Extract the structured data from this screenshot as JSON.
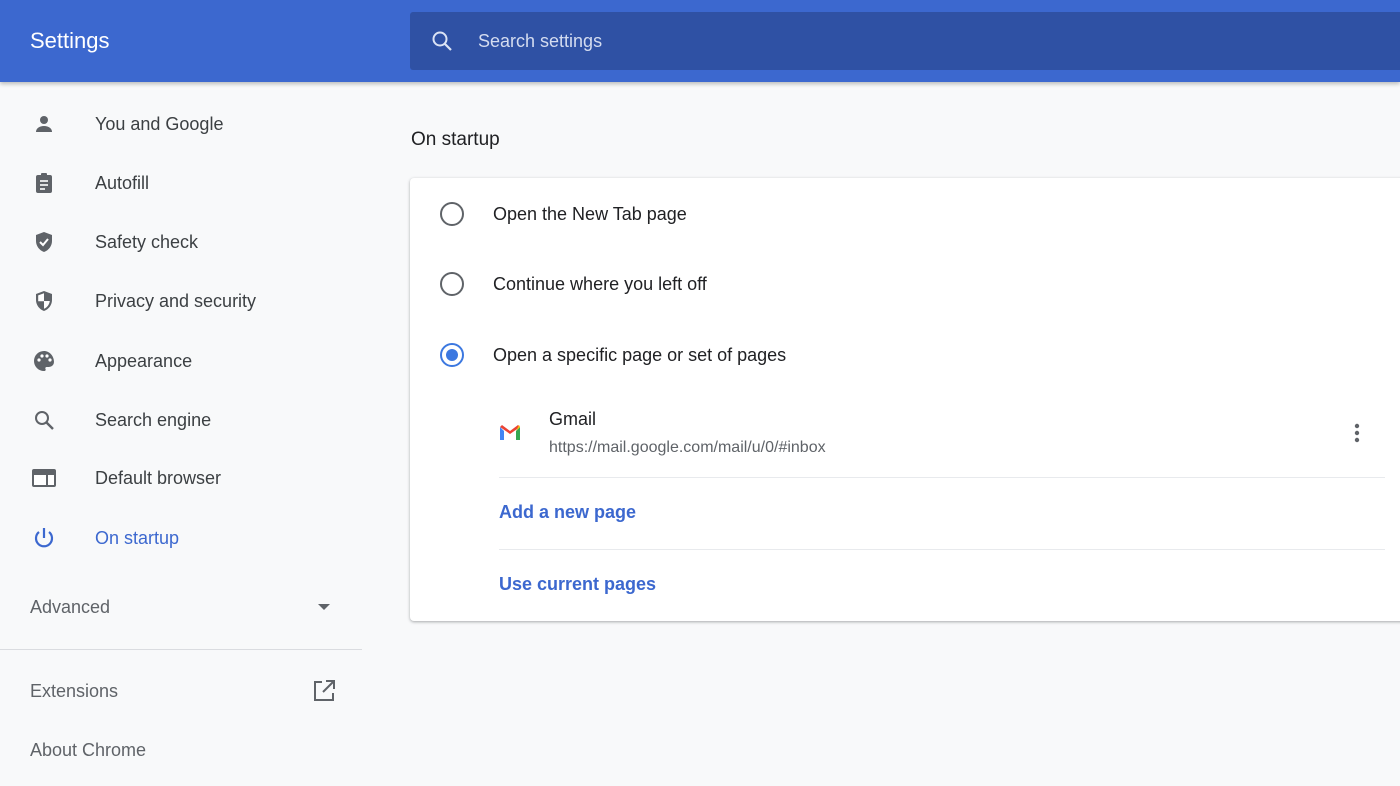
{
  "header": {
    "title": "Settings",
    "search_placeholder": "Search settings"
  },
  "sidebar": {
    "items": [
      {
        "label": "You and Google",
        "icon": "person-icon"
      },
      {
        "label": "Autofill",
        "icon": "clipboard-icon"
      },
      {
        "label": "Safety check",
        "icon": "shield-check-icon"
      },
      {
        "label": "Privacy and security",
        "icon": "shield-icon"
      },
      {
        "label": "Appearance",
        "icon": "palette-icon"
      },
      {
        "label": "Search engine",
        "icon": "search-icon"
      },
      {
        "label": "Default browser",
        "icon": "browser-icon"
      },
      {
        "label": "On startup",
        "icon": "power-icon",
        "active": true
      }
    ],
    "advanced": "Advanced",
    "extensions": "Extensions",
    "about": "About Chrome"
  },
  "main": {
    "section_title": "On startup",
    "options": [
      {
        "label": "Open the New Tab page",
        "selected": false
      },
      {
        "label": "Continue where you left off",
        "selected": false
      },
      {
        "label": "Open a specific page or set of pages",
        "selected": true
      }
    ],
    "pages": [
      {
        "name": "Gmail",
        "url": "https://mail.google.com/mail/u/0/#inbox"
      }
    ],
    "add_page": "Add a new page",
    "use_current": "Use current pages"
  },
  "colors": {
    "header": "#3c68cf",
    "search": "#2f51a4",
    "accent": "#3c68cf",
    "radio": "#3c78e0"
  }
}
